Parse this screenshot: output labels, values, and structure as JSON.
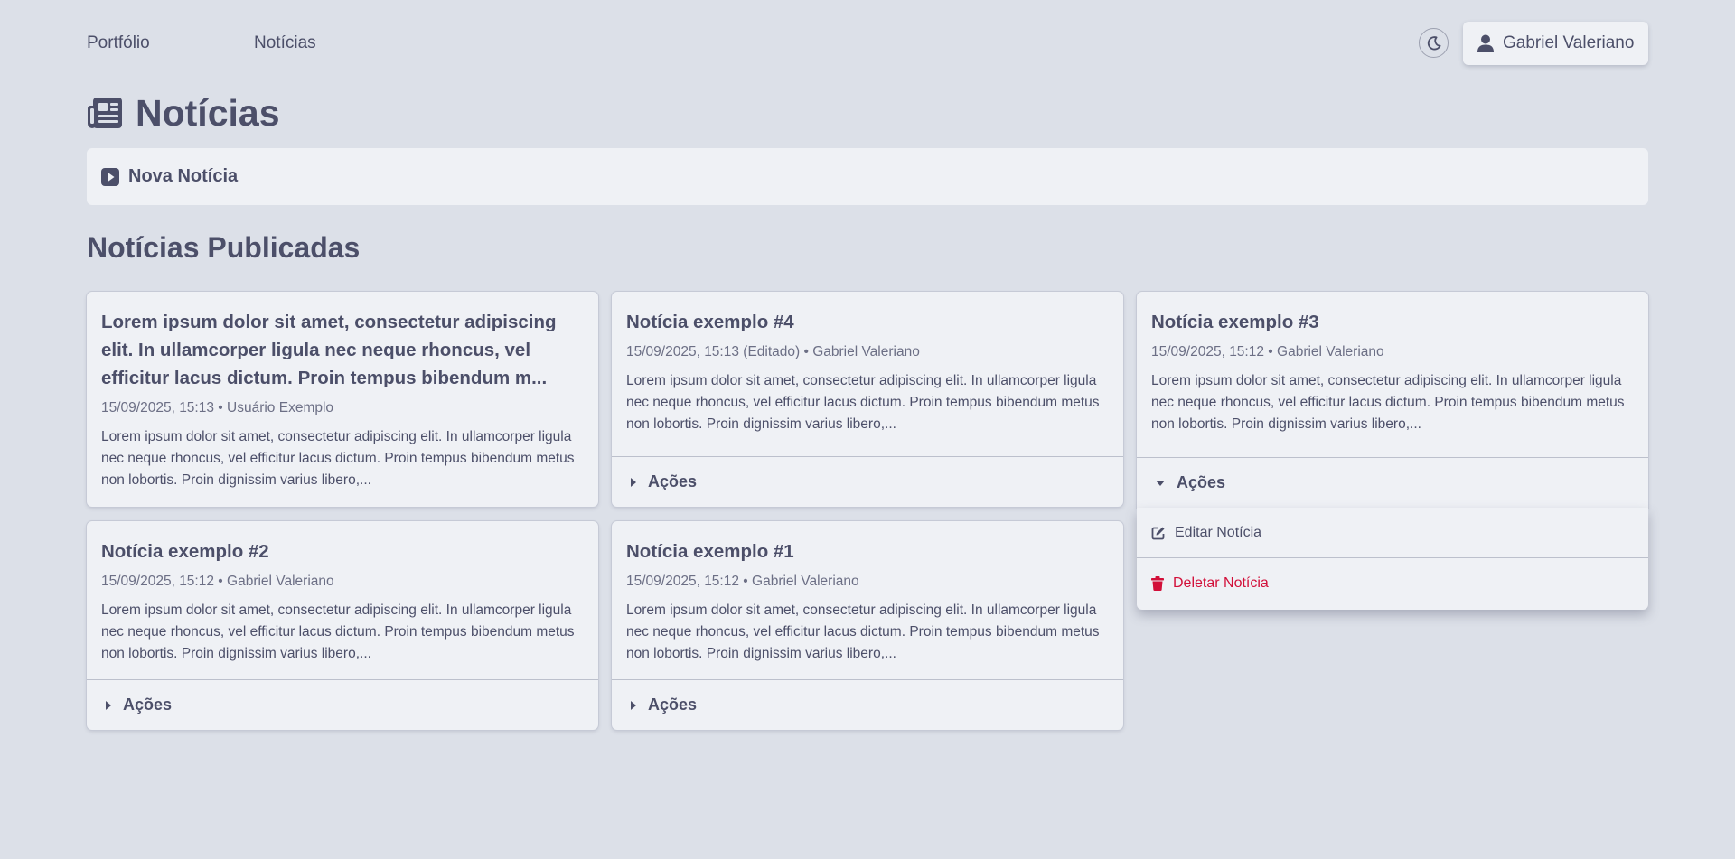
{
  "nav": {
    "links": [
      "Portfólio",
      "Notícias"
    ],
    "theme_toggle_icon": "moon-icon",
    "user_name": "Gabriel Valeriano"
  },
  "page": {
    "title": "Notícias",
    "new_news_label": "Nova Notícia",
    "section_title": "Notícias Publicadas"
  },
  "cards": [
    {
      "title": "Lorem ipsum dolor sit amet, consectetur adipiscing elit. In ullamcorper ligula nec neque rhoncus, vel efficitur lacus dictum. Proin tempus bibendum m...",
      "meta": "15/09/2025, 15:13 • Usuário Exemplo",
      "text": "Lorem ipsum dolor sit amet, consectetur adipiscing elit. In ullamcorper ligula nec neque rhoncus, vel efficitur lacus dictum. Proin tempus bibendum metus non lobortis. Proin dignissim varius libero,..."
    },
    {
      "title": "Notícia exemplo #4",
      "meta": "15/09/2025, 15:13 (Editado) • Gabriel Valeriano",
      "text": "Lorem ipsum dolor sit amet, consectetur adipiscing elit. In ullamcorper ligula nec neque rhoncus, vel efficitur lacus dictum. Proin tempus bibendum metus non lobortis. Proin dignissim varius libero,...",
      "actions_label": "Ações"
    },
    {
      "title": "Notícia exemplo #3",
      "meta": "15/09/2025, 15:12 • Gabriel Valeriano",
      "text": "Lorem ipsum dolor sit amet, consectetur adipiscing elit. In ullamcorper ligula nec neque rhoncus, vel efficitur lacus dictum. Proin tempus bibendum metus non lobortis. Proin dignissim varius libero,...",
      "actions_label": "Ações"
    },
    {
      "title": "Notícia exemplo #2",
      "meta": "15/09/2025, 15:12 • Gabriel Valeriano",
      "text": "Lorem ipsum dolor sit amet, consectetur adipiscing elit. In ullamcorper ligula nec neque rhoncus, vel efficitur lacus dictum. Proin tempus bibendum metus non lobortis. Proin dignissim varius libero,...",
      "actions_label": "Ações"
    },
    {
      "title": "Notícia exemplo #1",
      "meta": "15/09/2025, 15:12 • Gabriel Valeriano",
      "text": "Lorem ipsum dolor sit amet, consectetur adipiscing elit. In ullamcorper ligula nec neque rhoncus, vel efficitur lacus dictum. Proin tempus bibendum metus non lobortis. Proin dignissim varius libero,...",
      "actions_label": "Ações"
    }
  ],
  "dropdown": {
    "edit_label": "Editar Notícia",
    "delete_label": "Deletar Notícia"
  },
  "colors": {
    "background": "#dce0e8",
    "surface": "#eff1f5",
    "text": "#4c4f69",
    "danger": "#d20f39"
  }
}
